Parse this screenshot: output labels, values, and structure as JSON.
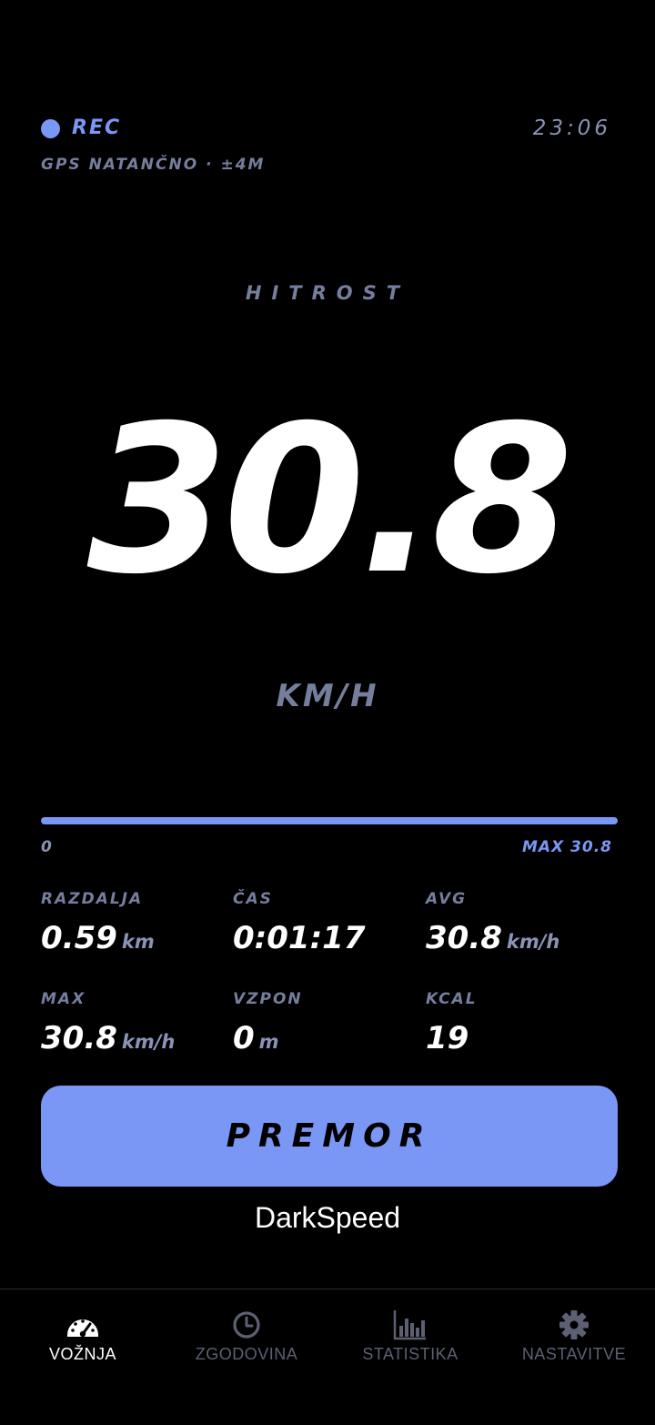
{
  "status": {
    "rec_label": "REC",
    "time": "23:06",
    "gps_text": "GPS NATANČNO · ±4M"
  },
  "speed": {
    "label": "HITROST",
    "value": "30.8",
    "unit": "KM/H"
  },
  "speed_bar": {
    "min_label": "0",
    "max_label": "MAX 30.8",
    "fill_fraction": 1.0
  },
  "stats": [
    {
      "label": "RAZDALJA",
      "value": "0.59",
      "unit": "km"
    },
    {
      "label": "ČAS",
      "value": "0:01:17",
      "unit": ""
    },
    {
      "label": "AVG",
      "value": "30.8",
      "unit": "km/h"
    },
    {
      "label": "MAX",
      "value": "30.8",
      "unit": "km/h"
    },
    {
      "label": "VZPON",
      "value": "0",
      "unit": "m"
    },
    {
      "label": "KCAL",
      "value": "19",
      "unit": ""
    }
  ],
  "pause_button": {
    "label": "PREMOR"
  },
  "app_name": "DarkSpeed",
  "tabs": [
    {
      "label": "VOŽNJA",
      "icon": "speedometer-icon",
      "active": true
    },
    {
      "label": "ZGODOVINA",
      "icon": "clock-icon",
      "active": false
    },
    {
      "label": "STATISTIKA",
      "icon": "bar-chart-icon",
      "active": false
    },
    {
      "label": "NASTAVITVE",
      "icon": "gear-icon",
      "active": false
    }
  ],
  "colors": {
    "accent": "#7b97f6",
    "background": "#000000",
    "muted": "#767e9d",
    "inactive_tab": "#5c6072"
  }
}
